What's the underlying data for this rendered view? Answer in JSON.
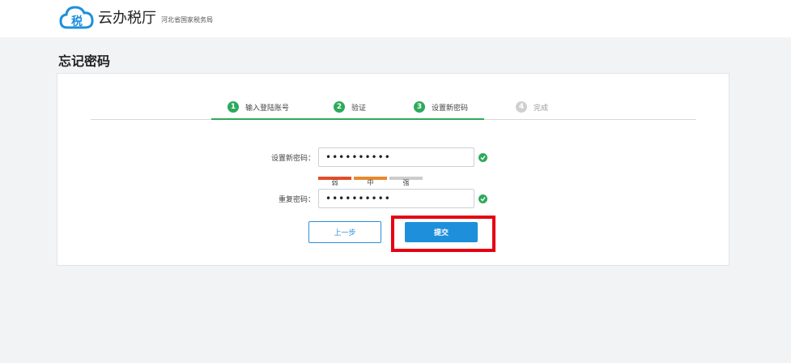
{
  "header": {
    "logo_char": "税",
    "app_name": "云办税厅",
    "org_name": "河北省国家税务局"
  },
  "page": {
    "title": "忘记密码"
  },
  "steps": [
    {
      "num": "1",
      "label": "输入登陆账号",
      "state": "done"
    },
    {
      "num": "2",
      "label": "验证",
      "state": "done"
    },
    {
      "num": "3",
      "label": "设置新密码",
      "state": "current"
    },
    {
      "num": "4",
      "label": "完成",
      "state": "pending"
    }
  ],
  "form": {
    "new_password": {
      "label": "设置新密码：",
      "value": "••••••••••",
      "valid": true
    },
    "strength": {
      "labels": [
        "弱",
        "中",
        "强"
      ],
      "level": 2,
      "colors": [
        "#e24d2a",
        "#e8892e",
        "#cccccc"
      ]
    },
    "confirm_password": {
      "label": "重复密码：",
      "value": "••••••••••",
      "valid": true
    }
  },
  "buttons": {
    "prev": "上一步",
    "submit": "提交"
  },
  "colors": {
    "accent": "#1e8fdb",
    "success": "#2daa5c",
    "highlight": "#e60012"
  }
}
